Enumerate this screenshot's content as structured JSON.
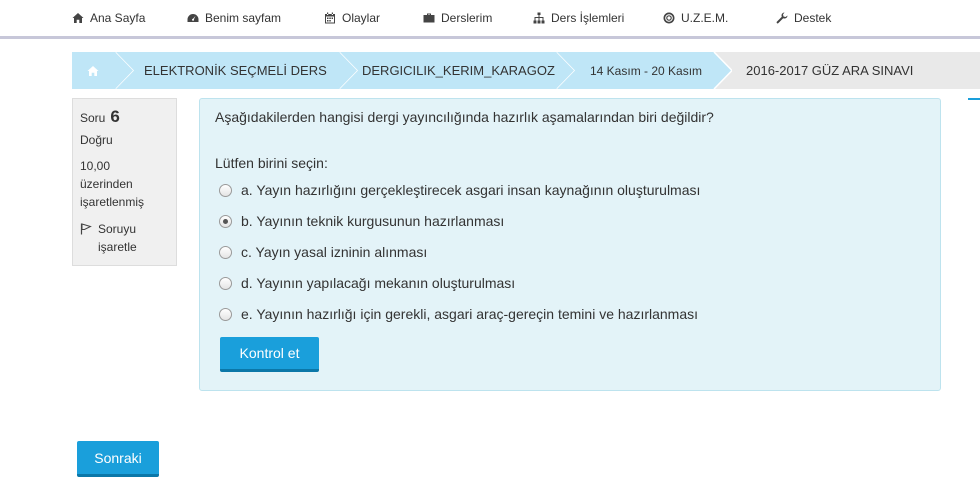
{
  "nav": {
    "items": [
      {
        "label": "Ana Sayfa",
        "icon": "home-icon"
      },
      {
        "label": "Benim sayfam",
        "icon": "dashboard-icon"
      },
      {
        "label": "Olaylar",
        "icon": "calendar-icon"
      },
      {
        "label": "Derslerim",
        "icon": "briefcase-icon"
      },
      {
        "label": "Ders İşlemleri",
        "icon": "sitemap-icon"
      },
      {
        "label": "U.Z.E.M.",
        "icon": "lifebuoy-icon"
      },
      {
        "label": "Destek",
        "icon": "wrench-icon"
      }
    ]
  },
  "breadcrumb": {
    "home_icon": "home-icon",
    "items": [
      "ELEKTRONİK SEÇMELİ DERS",
      "DERGICILIK_KERIM_KARAGOZ",
      "14 Kasım - 20 Kasım",
      "2016-2017 GÜZ ARA SINAVI"
    ]
  },
  "question_info": {
    "label": "Soru",
    "number": "6",
    "state": "Doğru",
    "grade": "10,00 üzerinden işaretlenmiş",
    "flag_label": "Soruyu işaretle"
  },
  "question": {
    "text": "Aşağıdakilerden hangisi dergi yayıncılığında hazırlık aşamalarından biri değildir?",
    "prompt": "Lütfen birini seçin:",
    "options": [
      {
        "label": "a. Yayın hazırlığını gerçekleştirecek asgari insan kaynağının oluşturulması",
        "selected": false
      },
      {
        "label": "b. Yayının teknik kurgusunun hazırlanması",
        "selected": true
      },
      {
        "label": "c. Yayın yasal izninin alınması",
        "selected": false
      },
      {
        "label": "d. Yayının yapılacağı mekanın oluşturulması",
        "selected": false
      },
      {
        "label": "e. Yayının hazırlığı için gerekli, asgari araç-gereçin temini ve hazırlanması",
        "selected": false
      }
    ],
    "check_button": "Kontrol et"
  },
  "footer": {
    "next_button": "Sonraki"
  },
  "colors": {
    "accent": "#1a9fdb",
    "breadcrumb_active": "#bfe6f7",
    "question_bg": "#e3f3f8"
  }
}
